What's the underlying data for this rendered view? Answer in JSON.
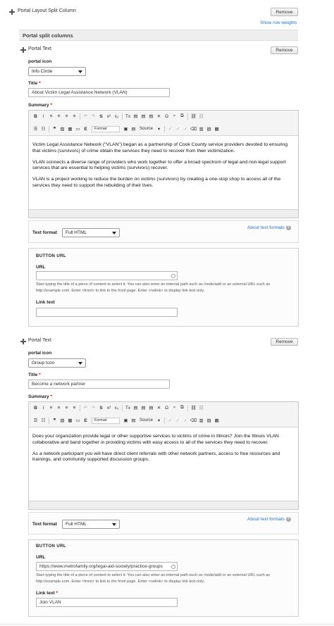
{
  "column": {
    "title": "Portal Layout Split Column",
    "remove_label": "Remove",
    "show_weights": "Show row weights"
  },
  "split": {
    "title": "Portal split columns"
  },
  "items": [
    {
      "title": "Portal Text",
      "remove_label": "Remove",
      "icon_label": "portal icon",
      "icon_value": "Info Circle",
      "title_label": "Title",
      "title_value": "About Victim Legal Assistance Network (VLAN)",
      "summary_label": "Summary",
      "paragraphs": [
        "Victim Legal Assistance Network (\"VLAN\") began as a partnership of Cook County service providers devoted to ensuring that victims (survivors) of crime obtain the services they need to recover from their victimization.",
        "VLAN connects a diverse range of providers who work together to offer a broad spectrum of legal and non-legal support services that are essential to helping victims (survivors) recover.",
        "VLAN is a project working to reduce the burden on victims (survivors) by creating a one-stop shop to access all of the services they need to support the rebuilding of their lives."
      ],
      "text_format_label": "Text format",
      "text_format_value": "Full HTML",
      "about_formats": "About text formats",
      "button_url_legend": "BUTTON URL",
      "url_label": "URL",
      "url_value": "",
      "url_desc": "Start typing the title of a piece of content to select it. You can also enter an internal path such as /node/add or an external URL such as http://example.com. Enter <front> to link to the front page. Enter <nolink> to display link text only.",
      "link_text_label": "Link text",
      "link_text_value": ""
    },
    {
      "title": "Portal Text",
      "remove_label": "Remove",
      "icon_label": "portal icon",
      "icon_value": "Group Icon",
      "title_label": "Title",
      "title_value": "Become a network partner",
      "summary_label": "Summary",
      "paragraphs": [
        "Does your organization provide legal or other supportive services to victims of crime in Illinois? Join the Illinois VLAN collaborative and band together in providing victims with easy access to all of the services they need to recover.",
        "As a network participant you will have direct client referrals with other network partners, access to free resources and trainings, and community supported discussion groups."
      ],
      "text_format_label": "Text format",
      "text_format_value": "Full HTML",
      "about_formats": "About text formats",
      "button_url_legend": "BUTTON URL",
      "url_label": "URL",
      "url_value": "https://www.metrofamily.org/legal-aid-society/practice-groups",
      "url_desc": "Start typing the title of a piece of content to select it. You can also enter an internal path such as /node/add or an external URL such as http://example.com. Enter <front> to link to the front page. Enter <nolink> to display link text only.",
      "link_text_label": "Link text",
      "link_text_value": "Join VLAN"
    }
  ],
  "toolbar": {
    "row1": [
      "B",
      "I",
      "≡",
      "≡",
      "≡",
      "≡",
      "↶",
      "↷",
      "S",
      "x²",
      "x₂",
      "Tx",
      "📋",
      "📋",
      "📋",
      "✕",
      "Ω",
      "🔍",
      "⧉",
      "🔗",
      "⛓"
    ],
    "row2": [
      "≔",
      "1.",
      "❝",
      "🖼",
      "▦",
      "─",
      "E",
      "Format",
      "💾",
      "📄",
      "Source",
      "✓",
      "✓",
      "✓",
      "⌦",
      "⊟",
      "⊞",
      "▣"
    ]
  },
  "colors": {
    "accent": "#2a73c4",
    "required": "#dd0000",
    "bar": "#eeeeee"
  }
}
